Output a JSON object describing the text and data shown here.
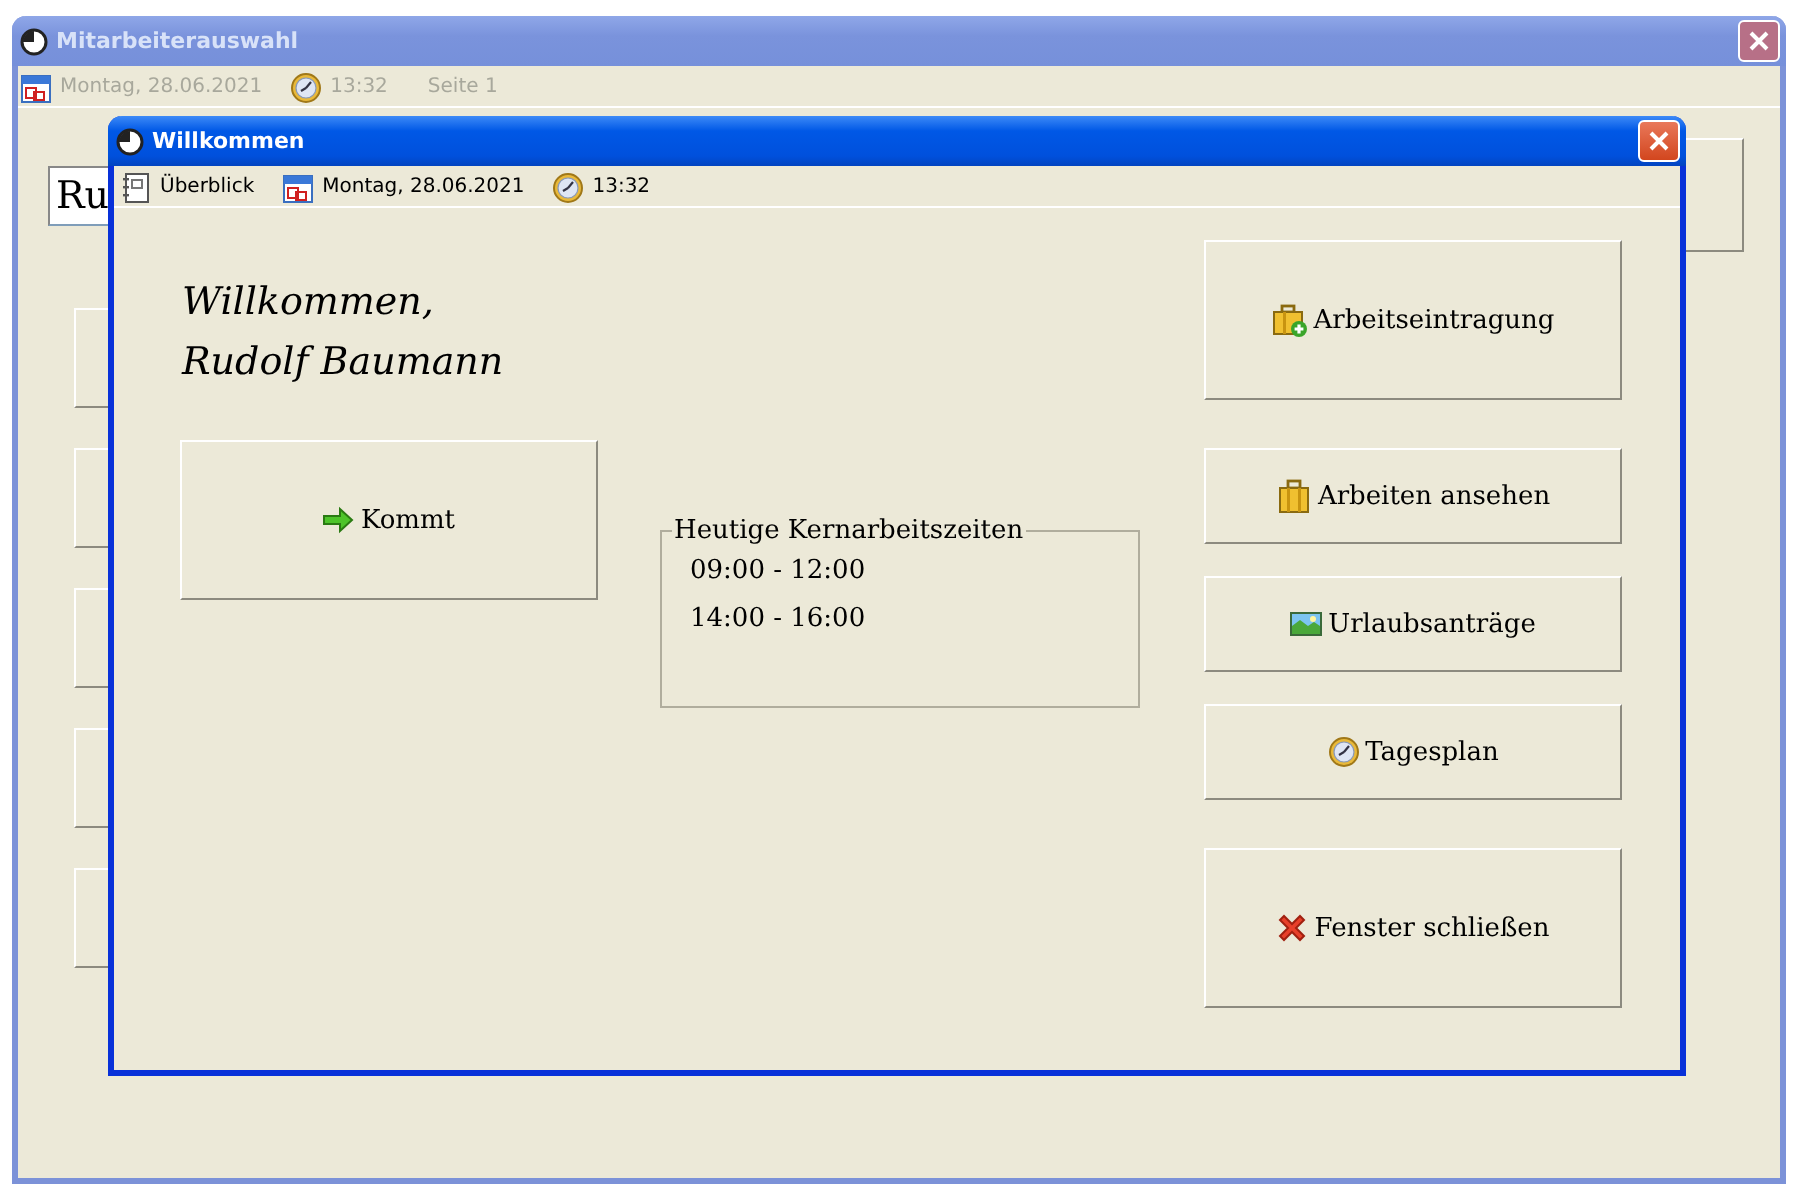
{
  "main_window": {
    "title": "Mitarbeiterauswahl",
    "active": false,
    "status": [
      {
        "kind": "calendar",
        "label": "Montag, 28.06.2021"
      },
      {
        "kind": "clock",
        "label": "13:32"
      },
      {
        "kind": "text",
        "label": "Seite 1"
      }
    ],
    "name_field": {
      "value": "Ru"
    }
  },
  "dialog": {
    "title": "Willkommen",
    "active": true,
    "toolbar": [
      {
        "kind": "overview",
        "label": "Überblick"
      },
      {
        "kind": "calendar",
        "label": "Montag, 28.06.2021"
      },
      {
        "kind": "clock",
        "label": "13:32"
      }
    ],
    "greeting": "Willkommen,",
    "user": "Rudolf Baumann",
    "clock_in": {
      "label": "Kommt"
    },
    "core_hours": {
      "title": "Heutige Kernarbeitszeiten",
      "slots": [
        "09:00 - 12:00",
        "14:00 - 16:00"
      ]
    },
    "actions": [
      {
        "label": "Arbeitseintragung"
      },
      {
        "label": "Arbeiten ansehen"
      },
      {
        "label": "Urlaubsanträge"
      },
      {
        "label": "Tagesplan"
      },
      {
        "label": "Fenster schließen"
      }
    ]
  }
}
